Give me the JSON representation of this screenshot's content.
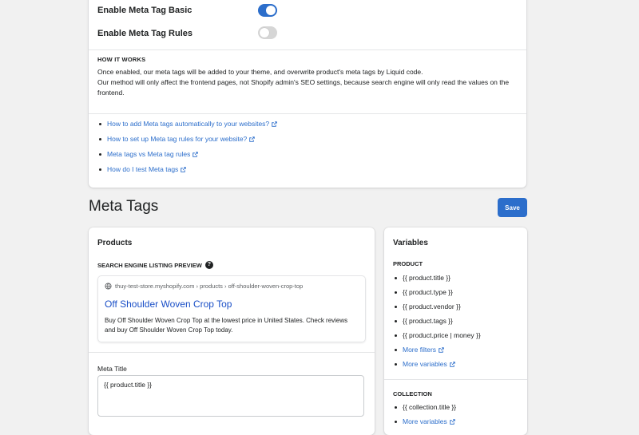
{
  "settings": {
    "toggles": [
      {
        "label": "Enable Meta Tag Basic",
        "on": true
      },
      {
        "label": "Enable Meta Tag Rules",
        "on": false
      }
    ],
    "how_it_works": {
      "heading": "HOW IT WORKS",
      "line1": "Once enabled, our meta tags will be added to your theme, and overwrite product's meta tags by Liquid code.",
      "line2": "Our method will only affect the frontend pages, not Shopify admin's SEO settings, because search engine will only read the values on the frontend."
    },
    "links": [
      "How to add Meta tags automatically to your websites?",
      "How to set up Meta tag rules for your website?",
      "Meta tags vs Meta tag rules",
      "How do I test Meta tags"
    ]
  },
  "page": {
    "title": "Meta Tags",
    "save_label": "Save"
  },
  "products": {
    "title": "Products",
    "preview_label": "SEARCH ENGINE LISTING PREVIEW",
    "preview": {
      "url": "thuy-test-store.myshopify.com › products › off-shoulder-woven-crop-top",
      "title": "Off Shoulder Woven Crop Top",
      "description": "Buy Off Shoulder Woven Crop Top at the lowest price in United States. Check reviews and buy Off Shoulder Woven Crop Top today."
    },
    "meta_title_label": "Meta Title",
    "meta_title_value": "{{ product.title }}"
  },
  "variables": {
    "title": "Variables",
    "product_heading": "PRODUCT",
    "product_vars": [
      "{{ product.title }}",
      "{{ product.type }}",
      "{{ product.vendor }}",
      "{{ product.tags }}",
      "{{ product.price | money }}"
    ],
    "more_filters": "More filters",
    "more_variables": "More variables",
    "collection_heading": "COLLECTION",
    "collection_vars": [
      "{{ collection.title }}"
    ],
    "collection_more_variables": "More variables"
  },
  "colors": {
    "accent": "#2c6ecb",
    "link": "#2c6ecb",
    "preview_title": "#1a4fc7"
  }
}
